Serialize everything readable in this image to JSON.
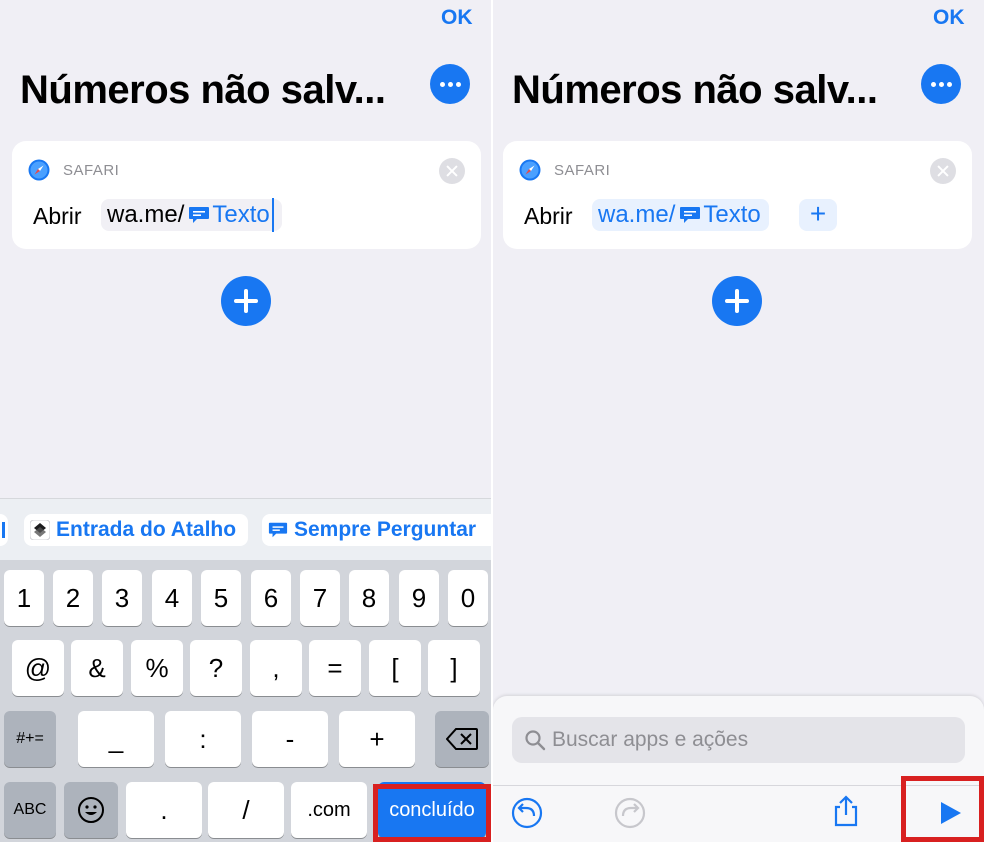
{
  "colors": {
    "accent": "#1877f2",
    "highlight": "#d82020",
    "background": "#f0eff5"
  },
  "left_panel": {
    "ok_label": "OK",
    "title": "Números não salv...",
    "card": {
      "app_label": "SAFARI",
      "action_label": "Abrir",
      "url_prefix": "wa.me/",
      "variable": "Texto"
    },
    "suggestions": [
      {
        "icon": "shortcut-input-icon",
        "label": "Entrada do Atalho"
      },
      {
        "icon": "message-bubble-icon",
        "label": "Sempre Perguntar"
      }
    ],
    "keyboard": {
      "row1": [
        "1",
        "2",
        "3",
        "4",
        "5",
        "6",
        "7",
        "8",
        "9",
        "0"
      ],
      "row2": [
        "@",
        "&",
        "%",
        "?",
        ",",
        "=",
        "[",
        "]"
      ],
      "row3": [
        "#+=",
        "_",
        ":",
        "-",
        "+"
      ],
      "row4": [
        "ABC",
        ".",
        "/",
        ".com",
        "concluído"
      ]
    }
  },
  "right_panel": {
    "ok_label": "OK",
    "title": "Números não salv...",
    "card": {
      "app_label": "SAFARI",
      "action_label": "Abrir",
      "url_prefix": "wa.me/",
      "variable": "Texto",
      "add_label": "+"
    },
    "search": {
      "placeholder": "Buscar apps e ações"
    },
    "toolbar": [
      "undo-icon",
      "redo-icon",
      "share-icon",
      "play-icon"
    ]
  }
}
